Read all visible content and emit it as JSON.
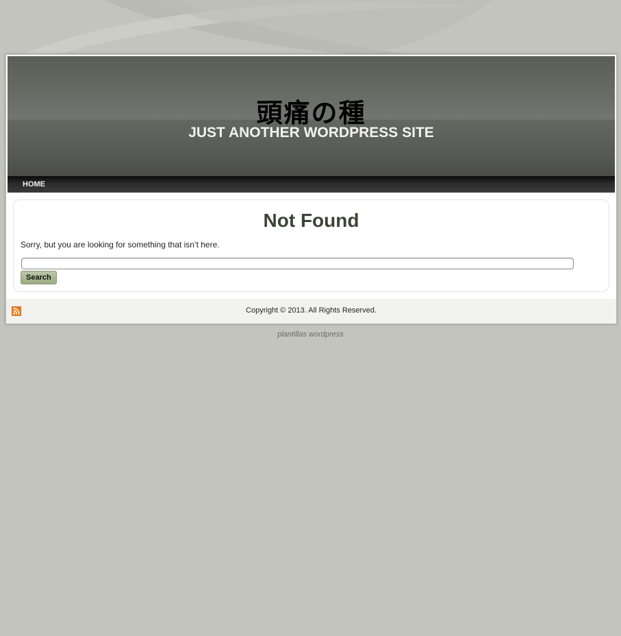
{
  "header": {
    "site_title": "頭痛の種",
    "site_description": "JUST ANOTHER WORDPRESS SITE"
  },
  "nav": {
    "items": [
      {
        "label": "HOME"
      }
    ]
  },
  "main": {
    "title": "Not Found",
    "message": "Sorry, but you are looking for something that isn’t here.",
    "search": {
      "value": "",
      "button_label": "Search"
    }
  },
  "footer": {
    "rss_icon": "rss-feed-icon",
    "copyright": "Copyright © 2013. All Rights Reserved."
  },
  "credit": {
    "text": "plantillas wordpress"
  },
  "colors": {
    "page_background": "#c4c4be",
    "header_dark": "#555752",
    "title_text": "#3e4337",
    "button_green": "#a8b893",
    "rss_orange": "#f07b1b"
  }
}
